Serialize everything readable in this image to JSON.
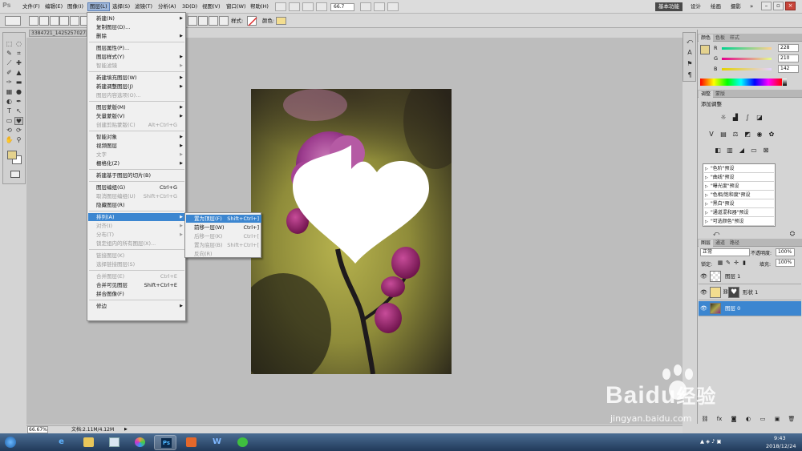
{
  "app": {
    "logo": "Ps",
    "zoom": "66.7",
    "workspace": {
      "active": "基本功能",
      "others": [
        "设计",
        "绘画",
        "摄影"
      ]
    }
  },
  "menubar": {
    "items": [
      "文件(F)",
      "编辑(E)",
      "图像(I)",
      "图层(L)",
      "选择(S)",
      "滤镜(T)",
      "分析(A)",
      "3D(D)",
      "视图(V)",
      "窗口(W)",
      "帮助(H)"
    ],
    "active_index": 3
  },
  "options": {
    "style_label": "样式:",
    "color_label": "颜色:",
    "color_swatch": "#f3dd8f"
  },
  "document": {
    "tab_title": "3384721_142525702760",
    "zoom_status": "66.67%",
    "doc_info": "文档:2.11M/4.12M"
  },
  "layer_menu": {
    "items": [
      {
        "label": "新建(N)",
        "has_submenu": true,
        "disabled": false
      },
      {
        "label": "复制图层(D)...",
        "disabled": false
      },
      {
        "label": "删除",
        "has_submenu": true,
        "disabled": false
      },
      {
        "label": "图层属性(P)...",
        "disabled": false
      },
      {
        "label": "图层样式(Y)",
        "has_submenu": true,
        "disabled": false
      },
      {
        "label": "智能滤镜",
        "disabled": true,
        "has_submenu": true
      },
      {
        "label": "新建填充图层(W)",
        "has_submenu": true,
        "disabled": false
      },
      {
        "label": "新建调整图层(J)",
        "has_submenu": true,
        "disabled": false
      },
      {
        "label": "图层内容选项(O)...",
        "disabled": true
      },
      {
        "label": "图层蒙版(M)",
        "has_submenu": true,
        "disabled": false
      },
      {
        "label": "矢量蒙版(V)",
        "has_submenu": true,
        "disabled": false
      },
      {
        "label": "创建剪贴蒙版(C)",
        "shortcut": "Alt+Ctrl+G",
        "disabled": true
      },
      {
        "label": "智能对象",
        "has_submenu": true,
        "disabled": false
      },
      {
        "label": "视频图层",
        "has_submenu": true,
        "disabled": false
      },
      {
        "label": "文字",
        "disabled": true,
        "has_submenu": true
      },
      {
        "label": "栅格化(Z)",
        "has_submenu": true,
        "disabled": false
      },
      {
        "label": "新建基于图层的切片(B)",
        "disabled": false
      },
      {
        "label": "图层编组(G)",
        "shortcut": "Ctrl+G",
        "disabled": false
      },
      {
        "label": "取消图层编组(U)",
        "shortcut": "Shift+Ctrl+G",
        "disabled": true
      },
      {
        "label": "隐藏图层(R)",
        "disabled": false
      },
      {
        "label": "排列(A)",
        "has_submenu": true,
        "disabled": false
      },
      {
        "label": "对齐(I)",
        "has_submenu": true,
        "disabled": true
      },
      {
        "label": "分布(T)",
        "has_submenu": true,
        "disabled": true
      },
      {
        "label": "锁定组内的所有图层(X)...",
        "disabled": true
      },
      {
        "label": "链接图层(K)",
        "disabled": true
      },
      {
        "label": "选择链接图层(S)",
        "disabled": true
      },
      {
        "label": "合并图层(E)",
        "shortcut": "Ctrl+E",
        "disabled": true
      },
      {
        "label": "合并可见图层",
        "shortcut": "Shift+Ctrl+E",
        "disabled": false
      },
      {
        "label": "拼合图像(F)",
        "disabled": false
      },
      {
        "label": "修边",
        "has_submenu": true,
        "disabled": false
      }
    ],
    "highlighted_index": 20
  },
  "arrange_submenu": {
    "items": [
      {
        "label": "置为顶层(F)",
        "shortcut": "Shift+Ctrl+]",
        "disabled": false
      },
      {
        "label": "前移一层(W)",
        "shortcut": "Ctrl+]",
        "disabled": false
      },
      {
        "label": "后移一层(K)",
        "shortcut": "Ctrl+[",
        "disabled": true
      },
      {
        "label": "置为底层(B)",
        "shortcut": "Shift+Ctrl+[",
        "disabled": true
      },
      {
        "label": "反向(R)",
        "disabled": true
      }
    ],
    "highlighted_index": 0
  },
  "color_panel": {
    "tabs": [
      "颜色",
      "色板",
      "样式"
    ],
    "r": {
      "label": "R",
      "value": "228"
    },
    "g": {
      "label": "G",
      "value": "210"
    },
    "b": {
      "label": "B",
      "value": "142"
    },
    "fg_color": "#e4d28e"
  },
  "adjust_panel": {
    "tabs": [
      "调整",
      "蒙版"
    ],
    "title": "添加调整",
    "presets": [
      "\"色阶\"预设",
      "\"曲线\"预设",
      "\"曝光度\"预设",
      "\"色相/饱和度\"预设",
      "\"黑白\"预设",
      "\"通道混和器\"预设",
      "\"可选颜色\"预设"
    ]
  },
  "layers_panel": {
    "tabs": [
      "图层",
      "通道",
      "路径"
    ],
    "blend_mode": "正常",
    "opacity_label": "不透明度:",
    "opacity": "100%",
    "lock_label": "锁定:",
    "fill_label": "填充:",
    "fill": "100%",
    "layers": [
      {
        "name": "图层 1",
        "selected": false
      },
      {
        "name": "形状 1",
        "selected": false
      },
      {
        "name": "图层 0",
        "selected": true
      }
    ]
  },
  "taskbar": {
    "time": "9:43",
    "date": "2018/12/24",
    "apps": [
      "windows-start",
      "ie",
      "explorer",
      "pictures",
      "photoshop",
      "wps-office",
      "wps-writer",
      "wechat"
    ],
    "active_app": "photoshop"
  },
  "watermark": {
    "brand": "Baidu",
    "cn": "经验",
    "url": "jingyan.baidu.com"
  }
}
